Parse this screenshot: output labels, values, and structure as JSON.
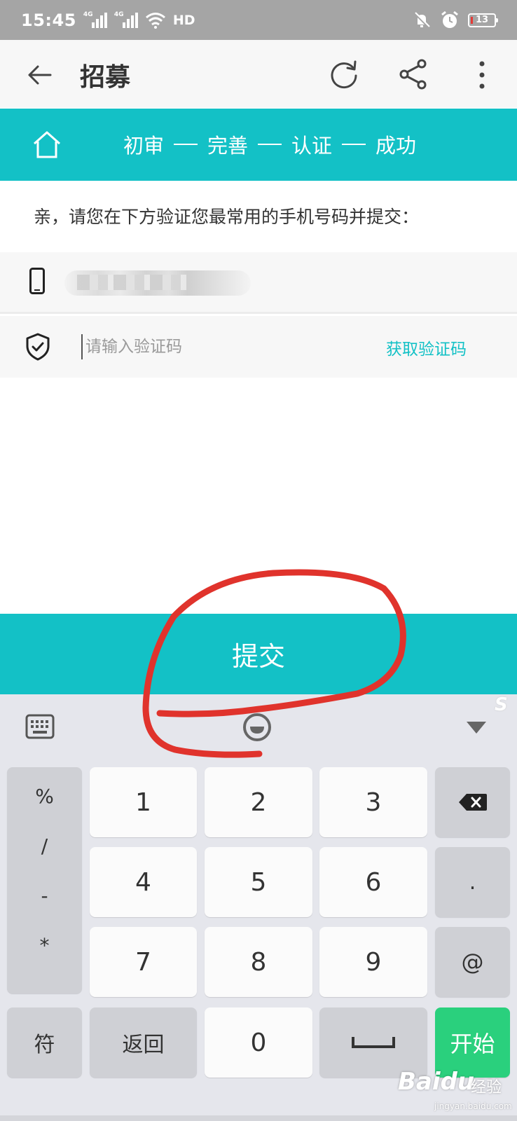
{
  "status_bar": {
    "time": "15:45",
    "signal1_tag": "4G",
    "signal2_tag": "4G",
    "hd": "HD",
    "battery_level": "13"
  },
  "header": {
    "title": "招募",
    "icons": [
      "back-arrow-icon",
      "refresh-icon",
      "share-icon",
      "more-vertical-icon"
    ]
  },
  "steps": {
    "items": [
      "初审",
      "完善",
      "认证",
      "成功"
    ],
    "separator": "—"
  },
  "instruction": "亲，请您在下方验证您最常用的手机号码并提交：",
  "form": {
    "phone_value": "",
    "code_placeholder": "请输入验证码",
    "get_code_label": "获取验证码"
  },
  "submit_label": "提交",
  "keyboard": {
    "symbols": [
      "%",
      "/",
      "-",
      "*"
    ],
    "digits": [
      "1",
      "2",
      "3",
      "4",
      "5",
      "6",
      "7",
      "8",
      "9",
      "0"
    ],
    "dot": ".",
    "at": "@",
    "fu": "符",
    "back": "返回",
    "go": "开始",
    "brand_s": "S"
  },
  "watermark": {
    "brand": "Baidu",
    "text": "经验",
    "url": "jingyan.baidu.com"
  },
  "colors": {
    "accent": "#13c1c6",
    "go_key": "#2ad07d",
    "annotation": "#e0332c",
    "status_bar": "#a5a5a5"
  }
}
